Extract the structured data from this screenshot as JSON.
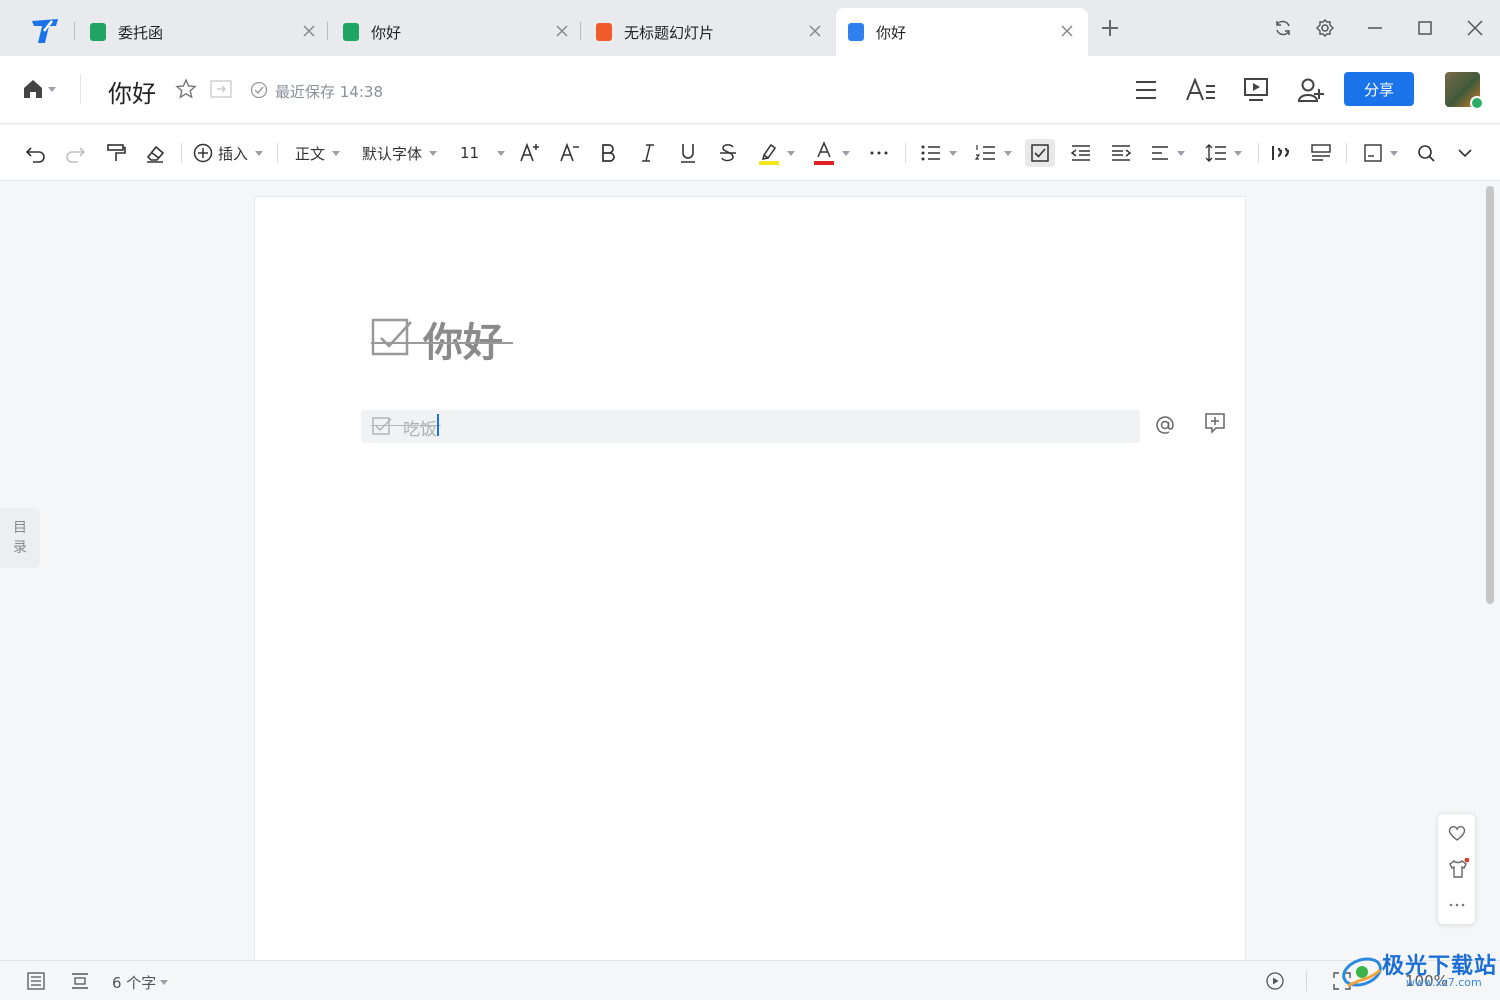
{
  "tabs": [
    {
      "label": "委托函",
      "type": "sheet",
      "color": "#1fa463",
      "active": false
    },
    {
      "label": "你好",
      "type": "sheet",
      "color": "#1fa463",
      "active": false
    },
    {
      "label": "无标题幻灯片",
      "type": "slides",
      "color": "#f05a28",
      "active": false
    },
    {
      "label": "你好",
      "type": "doc",
      "color": "#2f80ed",
      "active": true
    }
  ],
  "header": {
    "title": "你好",
    "save_status": "最近保存 14:38",
    "share_label": "分享"
  },
  "toolbar": {
    "insert_label": "插入",
    "style_label": "正文",
    "font_label": "默认字体",
    "size_label": "11",
    "highlight_color": "#f5e61c",
    "font_color": "#e02020"
  },
  "document": {
    "heading": "你好",
    "todo_item": "吃饭"
  },
  "sidebar": {
    "toc_label_1": "目",
    "toc_label_2": "录"
  },
  "status": {
    "word_count": "6 个字",
    "zoom": "100%"
  },
  "watermark": {
    "text": "极光下载站",
    "url": "www.xz7.com"
  }
}
